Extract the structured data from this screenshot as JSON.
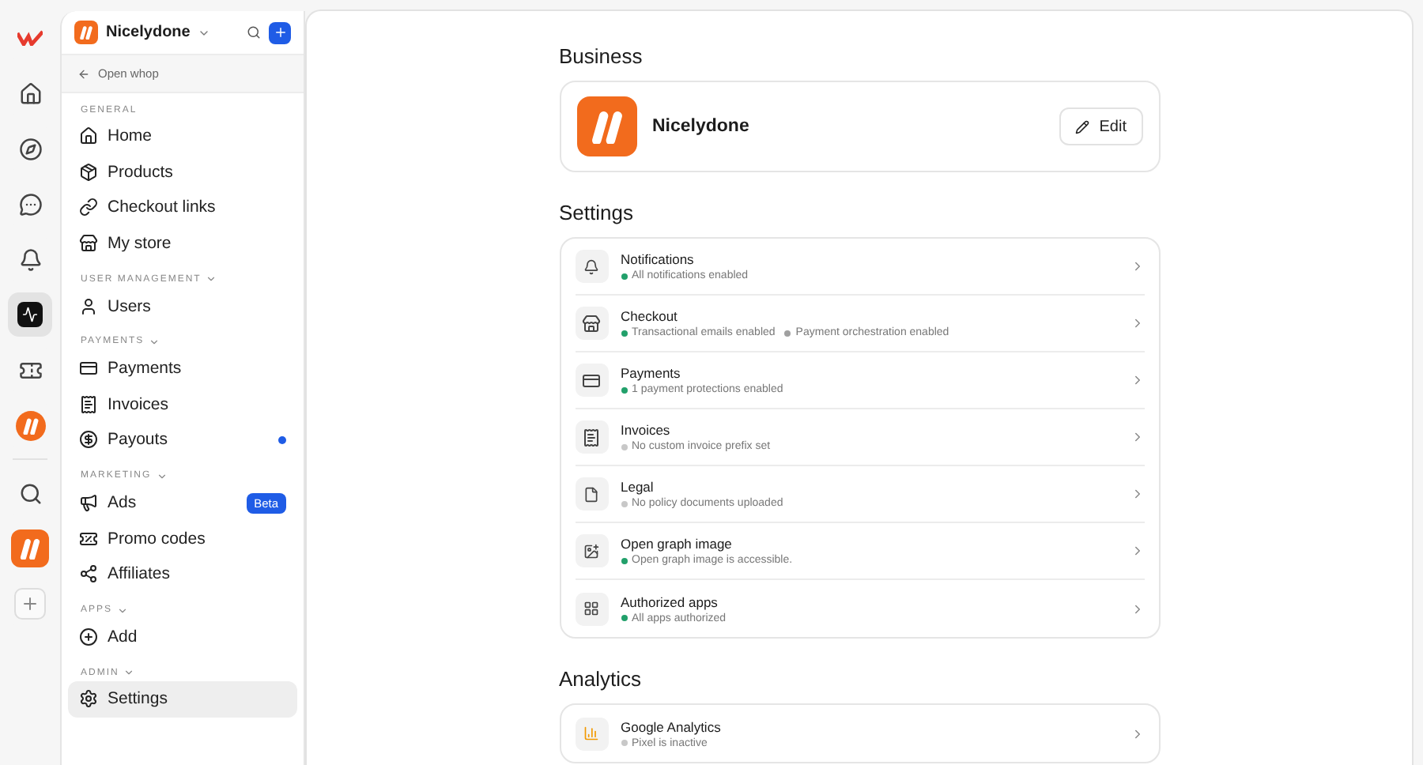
{
  "rail": [
    {
      "kind": "brand",
      "selected": false
    },
    {
      "kind": "home",
      "selected": false
    },
    {
      "kind": "compass",
      "selected": false
    },
    {
      "kind": "chat",
      "selected": false
    },
    {
      "kind": "bell",
      "selected": false
    },
    {
      "kind": "chart",
      "selected": true
    },
    {
      "kind": "ticket",
      "selected": false
    },
    {
      "kind": "whop",
      "selected": false
    },
    {
      "kind": "divider"
    },
    {
      "kind": "search",
      "selected": false
    },
    {
      "kind": "whop-large",
      "selected": false
    },
    {
      "kind": "plus",
      "selected": false
    }
  ],
  "sidebar": {
    "business": "Nicelydone",
    "back_link": "Open whop",
    "groups": [
      {
        "label": "GENERAL",
        "collapsible": false,
        "items": [
          {
            "label": "Home",
            "kind": "home",
            "selected": false
          },
          {
            "label": "Products",
            "kind": "box",
            "selected": false
          },
          {
            "label": "Checkout links",
            "kind": "link",
            "selected": false
          },
          {
            "label": "My store",
            "kind": "store",
            "selected": false
          }
        ]
      },
      {
        "label": "USER MANAGEMENT",
        "collapsible": true,
        "items": [
          {
            "label": "Users",
            "kind": "user",
            "selected": false
          }
        ]
      },
      {
        "label": "PAYMENTS",
        "collapsible": true,
        "items": [
          {
            "label": "Payments",
            "kind": "card",
            "selected": false
          },
          {
            "label": "Invoices",
            "kind": "receipt",
            "selected": false
          },
          {
            "label": "Payouts",
            "kind": "dollar",
            "selected": false,
            "dot": true
          }
        ]
      },
      {
        "label": "MARKETING",
        "collapsible": true,
        "items": [
          {
            "label": "Ads",
            "kind": "megaphone",
            "selected": false,
            "badge": "Beta"
          },
          {
            "label": "Promo codes",
            "kind": "percent",
            "selected": false
          },
          {
            "label": "Affiliates",
            "kind": "share",
            "selected": false
          }
        ]
      },
      {
        "label": "APPS",
        "collapsible": true,
        "items": [
          {
            "label": "Add",
            "kind": "plus",
            "selected": false
          }
        ]
      },
      {
        "label": "ADMIN",
        "collapsible": true,
        "items": [
          {
            "label": "Settings",
            "kind": "settings",
            "selected": true
          }
        ]
      }
    ]
  },
  "business": {
    "heading": "Business",
    "name": "Nicelydone",
    "edit_button": "Edit"
  },
  "settings": {
    "heading": "Settings",
    "rows": [
      {
        "kind": "bell",
        "title": "Notifications",
        "statuses": [
          {
            "text": "All notifications enabled",
            "color": "#22a06b"
          }
        ]
      },
      {
        "kind": "store",
        "title": "Checkout",
        "statuses": [
          {
            "text": "Transactional emails enabled",
            "color": "#22a06b"
          },
          {
            "text": "Payment orchestration enabled",
            "color": "#a0a0a0"
          }
        ]
      },
      {
        "kind": "card",
        "title": "Payments",
        "statuses": [
          {
            "text": "1 payment protections enabled",
            "color": "#22a06b"
          }
        ]
      },
      {
        "kind": "receipt",
        "title": "Invoices",
        "statuses": [
          {
            "text": "No custom invoice prefix set",
            "color": "#c8c8c8"
          }
        ]
      },
      {
        "kind": "file",
        "title": "Legal",
        "statuses": [
          {
            "text": "No policy documents uploaded",
            "color": "#c8c8c8"
          }
        ]
      },
      {
        "kind": "image",
        "title": "Open graph image",
        "statuses": [
          {
            "text": "Open graph image is accessible.",
            "color": "#22a06b"
          }
        ]
      },
      {
        "kind": "apps",
        "title": "Authorized apps",
        "statuses": [
          {
            "text": "All apps authorized",
            "color": "#22a06b"
          }
        ]
      }
    ]
  },
  "analytics": {
    "heading": "Analytics",
    "rows": [
      {
        "kind": "analytics",
        "title": "Google Analytics",
        "statuses": [
          {
            "text": "Pixel is inactive",
            "color": "#c8c8c8"
          }
        ]
      }
    ]
  }
}
